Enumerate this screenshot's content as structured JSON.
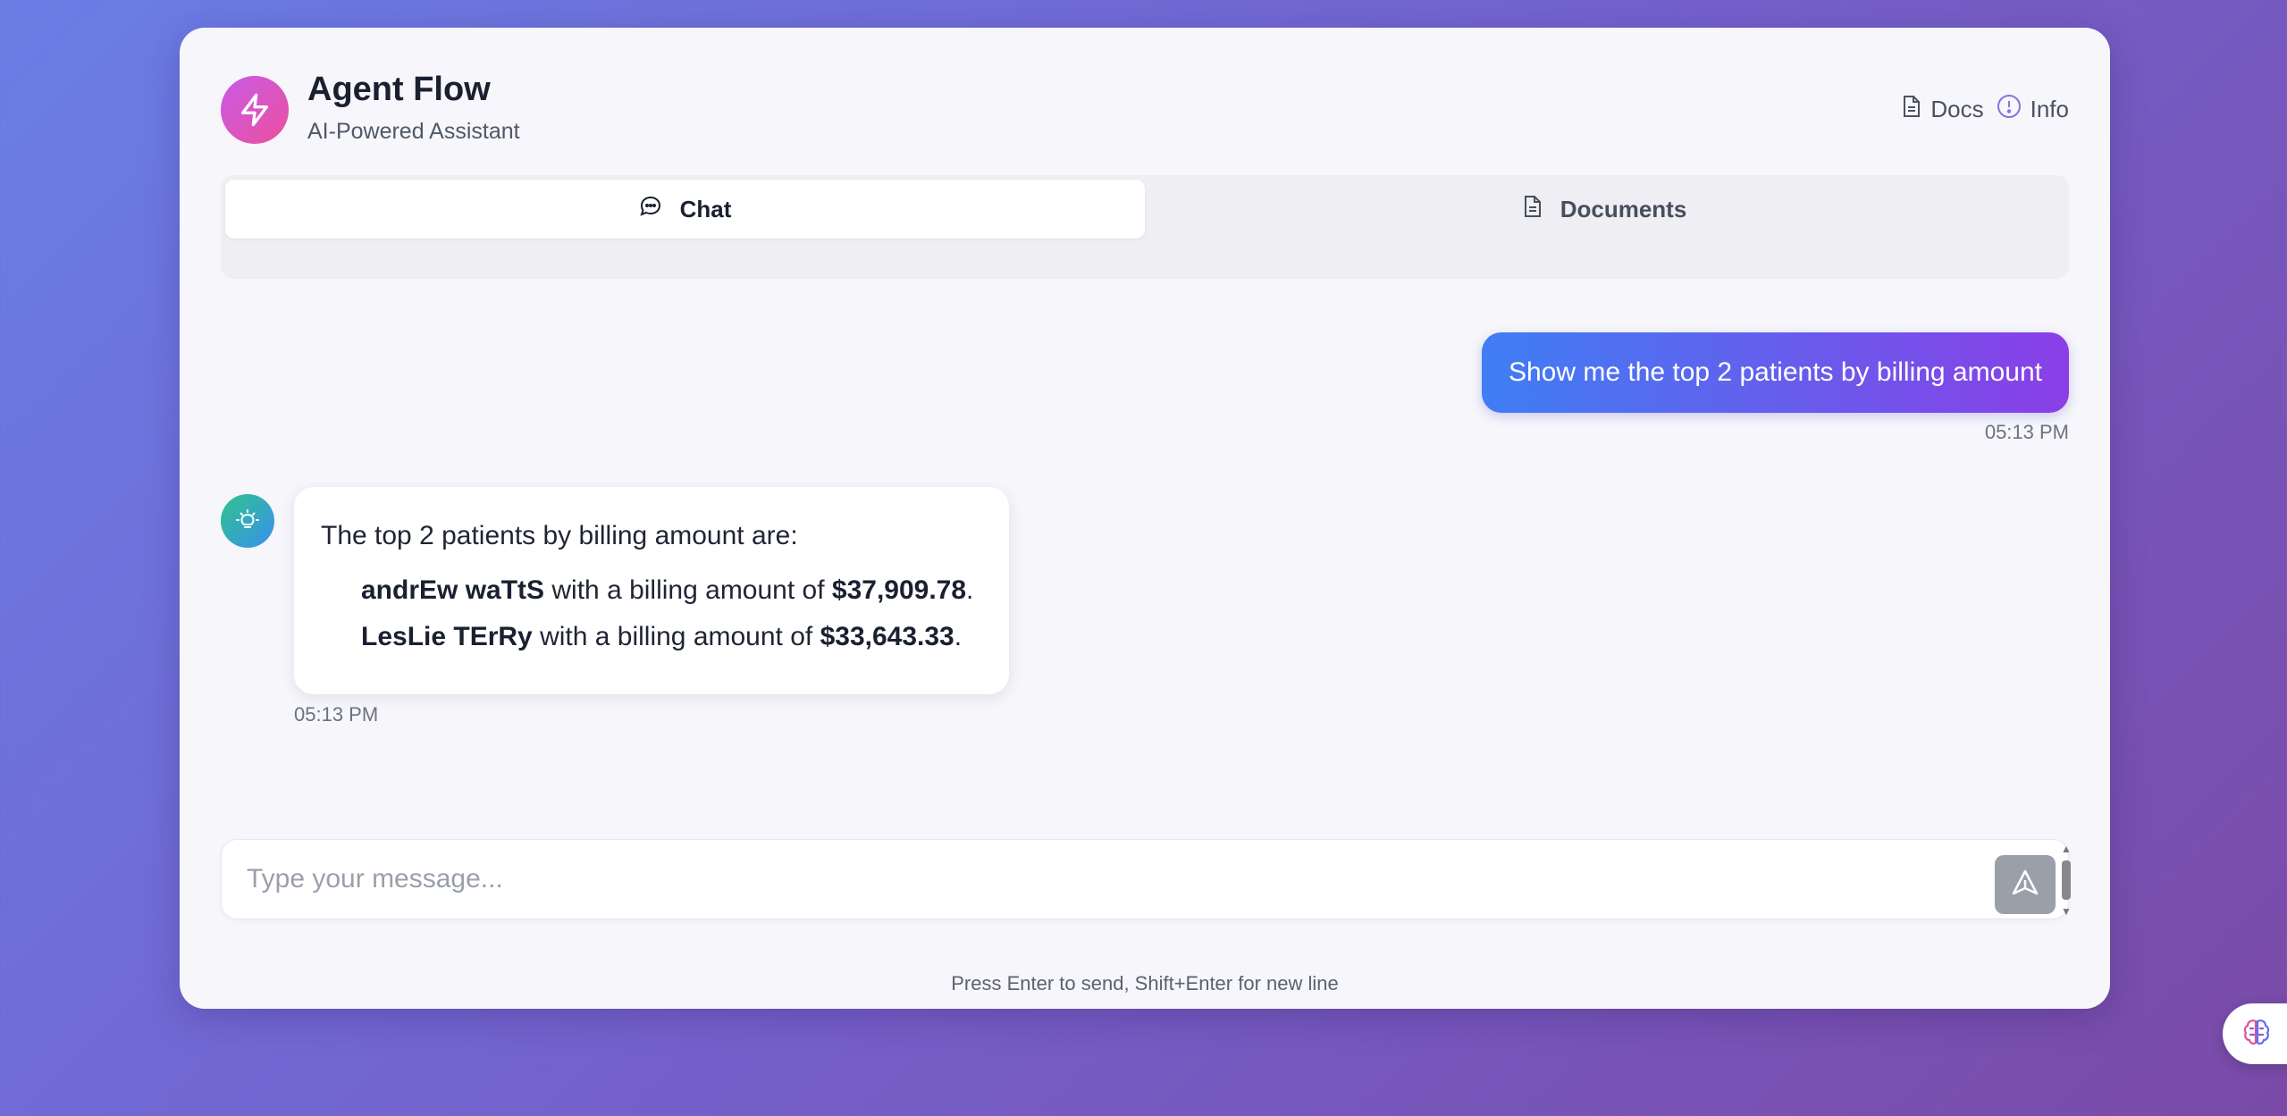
{
  "header": {
    "title": "Agent Flow",
    "subtitle": "AI-Powered Assistant",
    "links": [
      {
        "label": "Docs",
        "icon": "document-icon"
      },
      {
        "label": "Info",
        "icon": "info-icon"
      }
    ],
    "logo_icon": "lightning-icon",
    "logo_colors": [
      "#c95be8",
      "#ec4f9c"
    ]
  },
  "tabs": [
    {
      "label": "Chat",
      "icon": "chat-bubble-icon",
      "active": true
    },
    {
      "label": "Documents",
      "icon": "document-icon",
      "active": false
    }
  ],
  "messages": {
    "user": {
      "text": "Show me the top 2 patients by billing amount",
      "time": "05:13 PM"
    },
    "assistant": {
      "icon": "lightbulb-icon",
      "intro": "The top 2 patients by billing amount are:",
      "items": [
        {
          "name": "andrEw waTtS",
          "middle": " with a billing amount of ",
          "amount": "$37,909.78",
          "end": "."
        },
        {
          "name": "LesLie TErRy",
          "middle": " with a billing amount of ",
          "amount": "$33,643.33",
          "end": "."
        }
      ],
      "time": "05:13 PM"
    }
  },
  "composer": {
    "placeholder": "Type your message...",
    "value": "",
    "send_icon": "send-icon",
    "hint": "Press Enter to send, Shift+Enter for new line"
  },
  "floating_widget": {
    "icon": "brain-icon"
  },
  "colors": {
    "user_bubble_start": "#3f7ef4",
    "user_bubble_end": "#8a3fe6",
    "assistant_avatar_start": "#2fc48a",
    "assistant_avatar_end": "#3a8ff0"
  }
}
